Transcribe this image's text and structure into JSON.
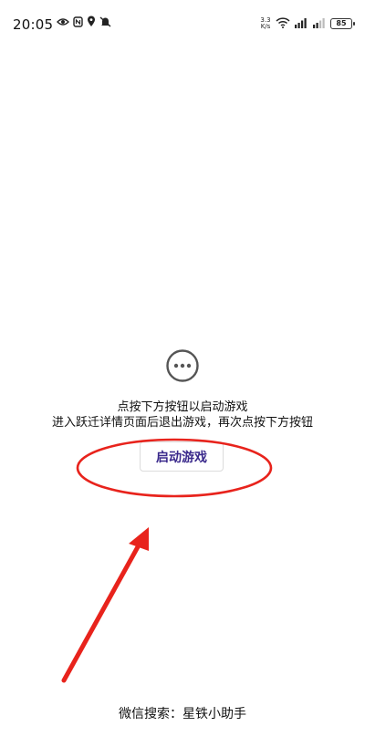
{
  "status_bar": {
    "time": "20:05",
    "net_speed_value": "3.3",
    "net_speed_unit": "K/s",
    "battery": "85",
    "left_icons": [
      "eye-icon",
      "nfc-icon",
      "location-icon",
      "mute-icon"
    ],
    "right_icons": [
      "wifi-icon",
      "signal-icon",
      "signal-icon",
      "battery-icon"
    ]
  },
  "page": {
    "more_icon": "more-horizontal-icon",
    "instruction_line1": "点按下方按钮以启动游戏",
    "instruction_line2": "进入跃迁详情页面后退出游戏，再次点按下方按钮",
    "start_button_label": "启动游戏",
    "bottom_text": "微信搜索：星铁小助手"
  },
  "colors": {
    "annotation_red": "#e8231c",
    "button_text": "#3b2a8c"
  }
}
